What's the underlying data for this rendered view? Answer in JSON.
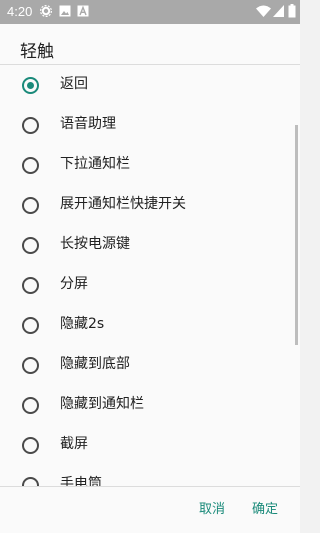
{
  "status_bar": {
    "time": "4:20",
    "icons": [
      "settings-gear-icon",
      "image-icon",
      "font-a-icon",
      "wifi-icon",
      "cell-signal-icon",
      "battery-icon"
    ]
  },
  "dialog": {
    "title": "轻触",
    "options": [
      {
        "label": "返回",
        "selected": true
      },
      {
        "label": "语音助理",
        "selected": false
      },
      {
        "label": "下拉通知栏",
        "selected": false
      },
      {
        "label": "展开通知栏快捷开关",
        "selected": false
      },
      {
        "label": "长按电源键",
        "selected": false
      },
      {
        "label": "分屏",
        "selected": false
      },
      {
        "label": "隐藏2s",
        "selected": false
      },
      {
        "label": "隐藏到底部",
        "selected": false
      },
      {
        "label": "隐藏到通知栏",
        "selected": false
      },
      {
        "label": "截屏",
        "selected": false
      },
      {
        "label": "手电筒",
        "selected": false
      }
    ],
    "buttons": {
      "cancel": "取消",
      "ok": "确定"
    }
  },
  "colors": {
    "accent": "#1a8a7a",
    "status_bar": "#a9a9a9"
  }
}
